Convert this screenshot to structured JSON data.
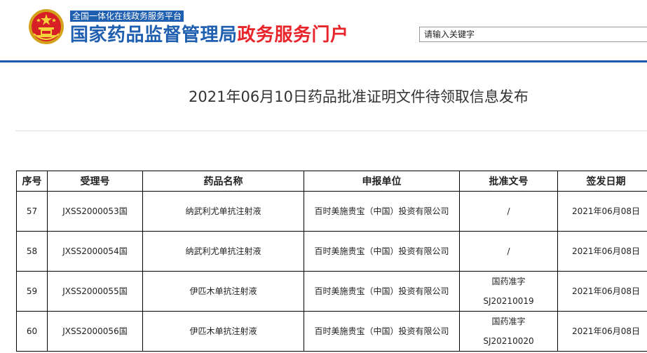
{
  "header": {
    "tagline": "全国一体化在线政务服务平台",
    "brand_main": "国家药品监督管理局",
    "brand_sub": "政务服务门户",
    "search_placeholder": "请输入关键字"
  },
  "page": {
    "title": "2021年06月10日药品批准证明文件待领取信息发布"
  },
  "table": {
    "headers": [
      "序号",
      "受理号",
      "药品名称",
      "申报单位",
      "批准文号",
      "签发日期"
    ],
    "rows": [
      {
        "no": "57",
        "accept_no": "JXSS2000053国",
        "drug": "纳武利尤单抗注射液",
        "applicant": "百时美施贵宝（中国）投资有限公司",
        "approval_1": "/",
        "approval_2": "",
        "date": "2021年06月08日"
      },
      {
        "no": "58",
        "accept_no": "JXSS2000054国",
        "drug": "纳武利尤单抗注射液",
        "applicant": "百时美施贵宝（中国）投资有限公司",
        "approval_1": "/",
        "approval_2": "",
        "date": "2021年06月08日"
      },
      {
        "no": "59",
        "accept_no": "JXSS2000055国",
        "drug": "伊匹木单抗注射液",
        "applicant": "百时美施贵宝（中国）投资有限公司",
        "approval_1": "国药准字",
        "approval_2": "SJ20210019",
        "date": "2021年06月08日"
      },
      {
        "no": "60",
        "accept_no": "JXSS2000056国",
        "drug": "伊匹木单抗注射液",
        "applicant": "百时美施贵宝（中国）投资有限公司",
        "approval_1": "国药准字",
        "approval_2": "SJ20210020",
        "date": "2021年06月08日"
      }
    ]
  },
  "colors": {
    "brand_blue": "#1f5fb0",
    "brand_red": "#e8252b",
    "header_line": "#1e5aa8"
  }
}
